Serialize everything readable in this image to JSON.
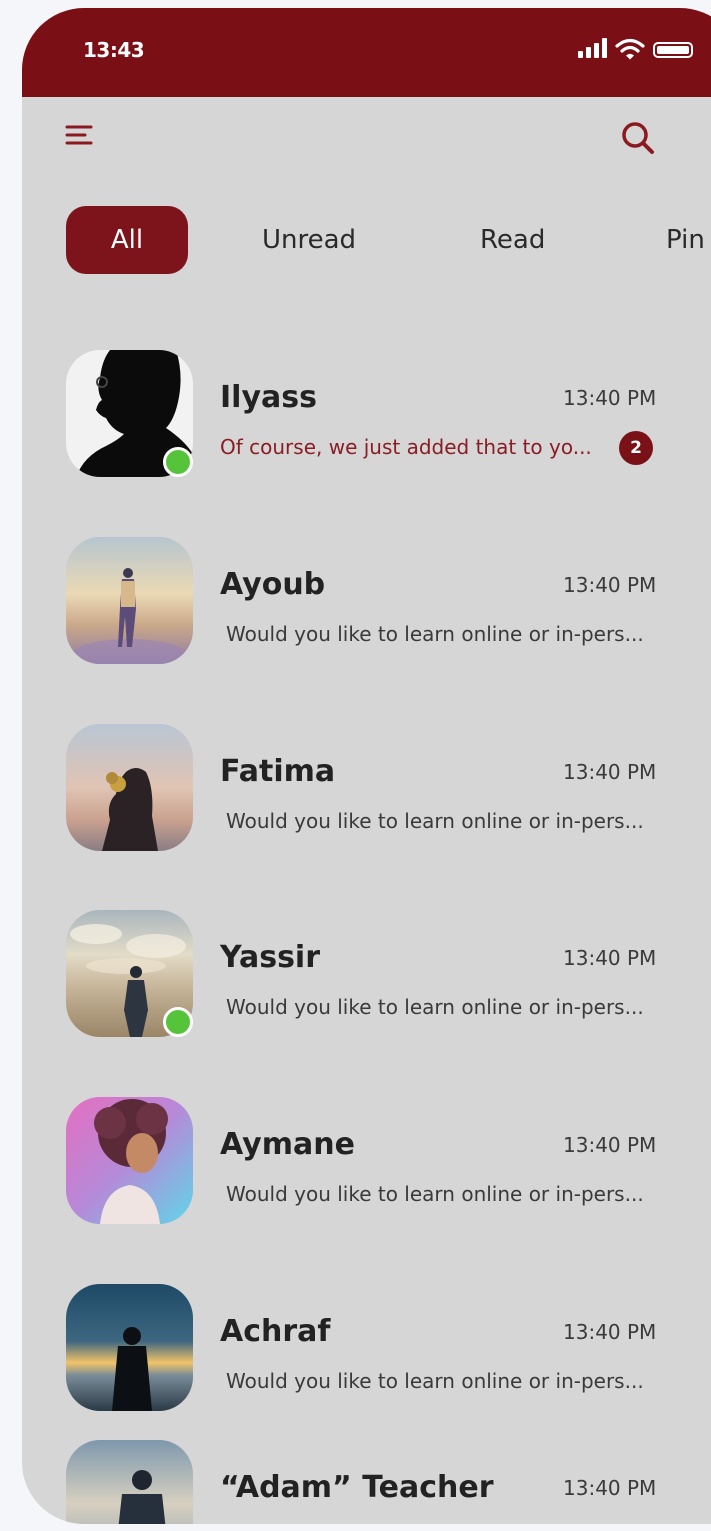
{
  "status_bar": {
    "time": "13:43"
  },
  "tabs": [
    {
      "label": "All",
      "active": true
    },
    {
      "label": "Unread",
      "active": false
    },
    {
      "label": "Read",
      "active": false
    },
    {
      "label": "Pin",
      "active": false
    }
  ],
  "chats": [
    {
      "name": "Ilyass",
      "time": "13:40 PM",
      "preview": "Of course, we just added that to yo...",
      "unread_count": "2",
      "online": true,
      "avatar": "silhouette-portrait"
    },
    {
      "name": "Ayoub",
      "time": "13:40 PM",
      "preview": "Would you like to learn online or in-pers...",
      "online": false,
      "avatar": "man-walking-desert"
    },
    {
      "name": "Fatima",
      "time": "13:40 PM",
      "preview": "Would you like to learn online or in-pers...",
      "online": false,
      "avatar": "woman-with-flowers"
    },
    {
      "name": "Yassir",
      "time": "13:40 PM",
      "preview": "Would you like to learn online or in-pers...",
      "online": true,
      "avatar": "man-on-beach-clouds"
    },
    {
      "name": "Aymane",
      "time": "13:40 PM",
      "preview": "Would you like to learn online or in-pers...",
      "online": false,
      "avatar": "curly-hair-boy-illustration"
    },
    {
      "name": "Achraf",
      "time": "13:40 PM",
      "preview": "Would you like to learn online or in-pers...",
      "online": false,
      "avatar": "man-silhouette-sunset"
    },
    {
      "name": "“Adam” Teacher",
      "time": "13:40 PM",
      "preview": "",
      "online": false,
      "avatar": "man-facing-sky"
    }
  ],
  "colors": {
    "brand": "#7b0f16",
    "background": "#d6d6d6",
    "online": "#56c43a",
    "unread_text": "#8a1d24"
  },
  "icons": {
    "menu": "menu-icon",
    "search": "search-icon",
    "signal": "signal-icon",
    "wifi": "wifi-icon",
    "battery": "battery-icon"
  }
}
